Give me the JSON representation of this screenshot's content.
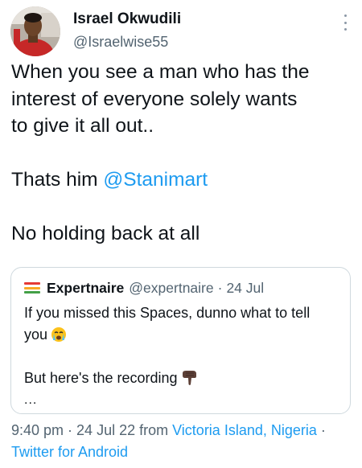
{
  "author": {
    "name": "Israel Okwudili",
    "handle": "@Israelwise55"
  },
  "menu_icon": "more-vertical-icon",
  "tweet": {
    "line1": "When you see a man who has the",
    "line2": "interest of everyone solely wants",
    "line3": "to give it all out..",
    "line4_prefix": "Thats him ",
    "line4_mention": "@Stanimart",
    "line5": "No holding back at all"
  },
  "quoted_tweet": {
    "name": "Expertnaire",
    "handle": "@expertnaire",
    "separator": "·",
    "date": "24 Jul",
    "logo_colors": [
      "#e53935",
      "#f9a825",
      "#43a047"
    ],
    "line1": "If you missed this Spaces, dunno what to tell",
    "line2": "you",
    "line2_emoji": "crying-face-emoji",
    "line3": "But here's the recording",
    "line3_emoji": "pointing-down-hand-emoji",
    "ellipsis": "..."
  },
  "meta": {
    "time": "9:40 pm",
    "sep1": " · ",
    "date": "24 Jul 22",
    "from": " from ",
    "location": "Victoria Island, Nigeria",
    "sep2": " ·",
    "client": "Twitter for Android"
  }
}
